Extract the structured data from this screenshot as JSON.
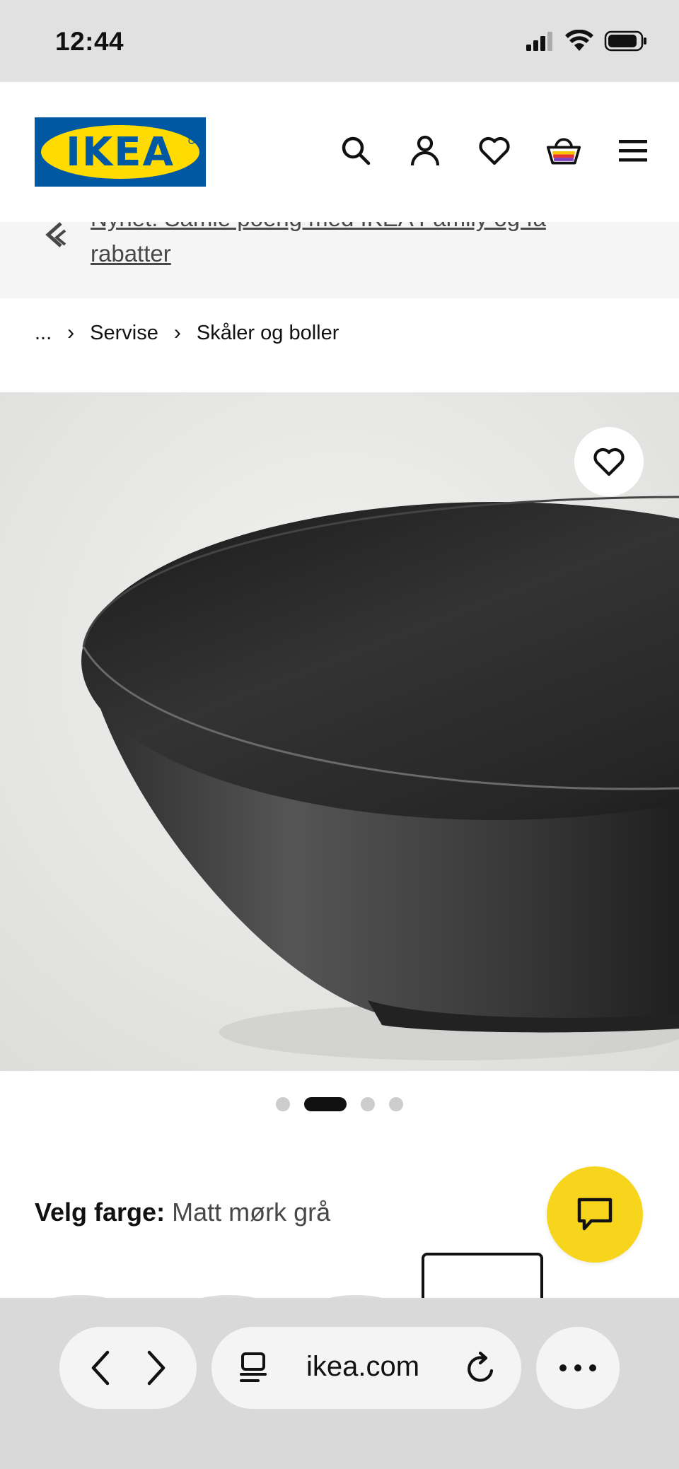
{
  "status_bar": {
    "time": "12:44"
  },
  "header": {
    "logo_text": "IKEA",
    "icons": [
      "search-icon",
      "account-icon",
      "heart-icon",
      "basket-icon",
      "menu-icon"
    ]
  },
  "banner": {
    "text": "Nyhet! Samle poeng med IKEA Family og få rabatter"
  },
  "breadcrumb": {
    "items": [
      "...",
      "Servise",
      "Skåler og boller"
    ]
  },
  "carousel": {
    "dot_count": 4,
    "active_index": 1
  },
  "color_selector": {
    "label": "Velg farge:",
    "value": "Matt mørk grå"
  },
  "browser": {
    "url": "ikea.com"
  },
  "colors": {
    "ikea_blue": "#0058a3",
    "ikea_yellow": "#ffdb00",
    "chat_yellow": "#f7d51d"
  }
}
